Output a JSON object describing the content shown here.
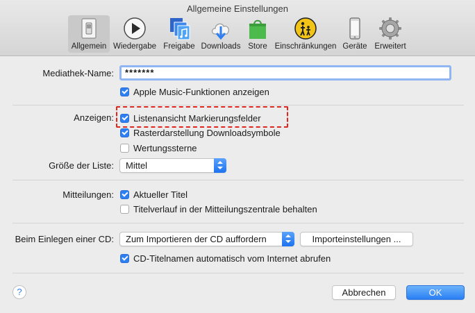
{
  "window": {
    "title": "Allgemeine Einstellungen"
  },
  "toolbar": {
    "items": [
      {
        "label": "Allgemein",
        "icon": "switch-icon",
        "selected": true
      },
      {
        "label": "Wiedergabe",
        "icon": "play-icon",
        "selected": false
      },
      {
        "label": "Freigabe",
        "icon": "music-library-icon",
        "selected": false
      },
      {
        "label": "Downloads",
        "icon": "cloud-download-icon",
        "selected": false
      },
      {
        "label": "Store",
        "icon": "shopping-bag-icon",
        "selected": false
      },
      {
        "label": "Einschränkungen",
        "icon": "parental-controls-icon",
        "selected": false
      },
      {
        "label": "Geräte",
        "icon": "iphone-icon",
        "selected": false
      },
      {
        "label": "Erweitert",
        "icon": "gear-icon",
        "selected": false
      }
    ]
  },
  "library": {
    "name_label": "Mediathek-Name:",
    "name_value": "*******",
    "apple_music_label": "Apple Music-Funktionen anzeigen",
    "apple_music_checked": true
  },
  "view": {
    "label": "Anzeigen:",
    "list_checkboxes_label": "Listenansicht Markierungsfelder",
    "list_checkboxes_checked": true,
    "grid_downloads_label": "Rasterdarstellung Downloadsymbole",
    "grid_downloads_checked": true,
    "ratings_label": "Wertungssterne",
    "ratings_checked": false,
    "list_size_label": "Größe der Liste:",
    "list_size_value": "Mittel"
  },
  "notifications": {
    "label": "Mitteilungen:",
    "current_title_label": "Aktueller Titel",
    "current_title_checked": true,
    "history_label": "Titelverlauf in der Mitteilungszentrale behalten",
    "history_checked": false
  },
  "cd": {
    "label": "Beim Einlegen einer CD:",
    "action_value": "Zum Importieren der CD auffordern",
    "import_settings_label": "Importeinstellungen ...",
    "cd_names_label": "CD-Titelnamen automatisch vom Internet abrufen",
    "cd_names_checked": true
  },
  "footer": {
    "help_label": "?",
    "cancel_label": "Abbrechen",
    "ok_label": "OK"
  },
  "colors": {
    "accent": "#2f7ff4",
    "highlight": "#e0251f"
  }
}
